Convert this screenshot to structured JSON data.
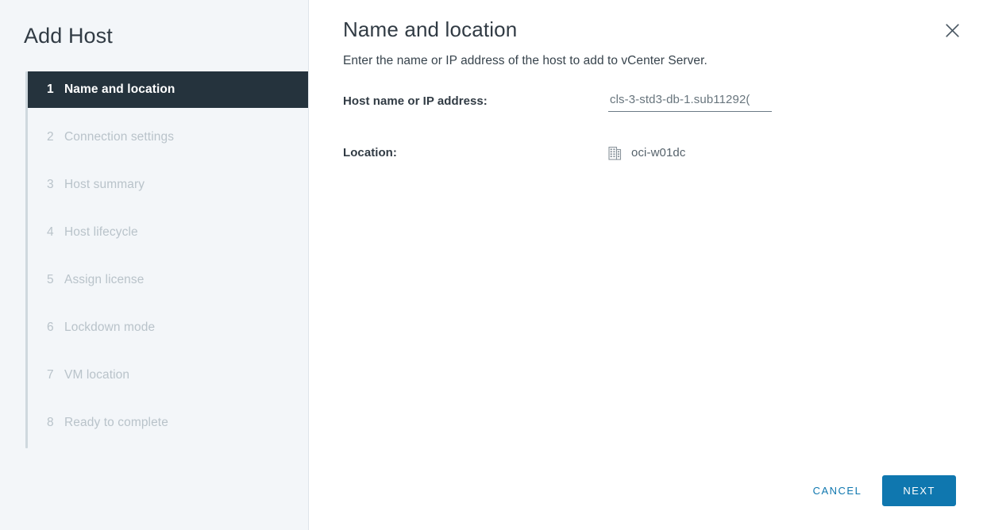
{
  "wizard": {
    "title": "Add Host",
    "steps": [
      {
        "num": "1",
        "label": "Name and location"
      },
      {
        "num": "2",
        "label": "Connection settings"
      },
      {
        "num": "3",
        "label": "Host summary"
      },
      {
        "num": "4",
        "label": "Host lifecycle"
      },
      {
        "num": "5",
        "label": "Assign license"
      },
      {
        "num": "6",
        "label": "Lockdown mode"
      },
      {
        "num": "7",
        "label": "VM location"
      },
      {
        "num": "8",
        "label": "Ready to complete"
      }
    ],
    "active_step_index": 0
  },
  "panel": {
    "title": "Name and location",
    "subtitle": "Enter the name or IP address of the host to add to vCenter Server.",
    "close_icon": "close-icon"
  },
  "form": {
    "host": {
      "label": "Host name or IP address:",
      "value": "cls-3-std3-db-1.sub11292(",
      "placeholder": ""
    },
    "location": {
      "label": "Location:",
      "icon": "datacenter-icon",
      "value": "oci-w01dc"
    }
  },
  "footer": {
    "cancel_label": "CANCEL",
    "next_label": "NEXT"
  },
  "colors": {
    "accent": "#0f77af",
    "active_step_bg": "#25333d",
    "sidebar_bg": "#f3f6f9",
    "text_primary": "#313b44",
    "text_muted": "#b9c3ca"
  }
}
